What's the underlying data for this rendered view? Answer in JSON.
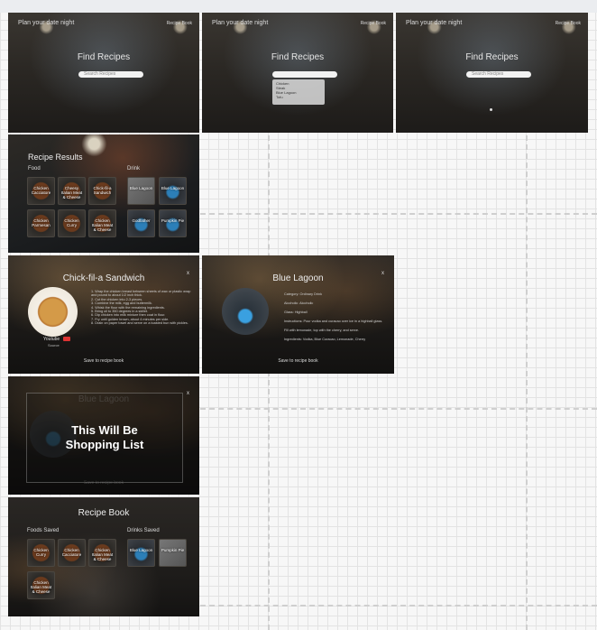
{
  "frames": {
    "landing": {
      "nav_title": "Plan your date night",
      "nav_link": "Recipe Book",
      "find_title": "Find Recipes",
      "search_placeholder": "Search Recipes"
    },
    "dropdown_options": [
      "Chicken",
      "Steak",
      "Blue Lagoon",
      "Tofu"
    ],
    "results": {
      "title": "Recipe Results",
      "food_label": "Food",
      "drink_label": "Drink",
      "food_tiles": [
        "Chicken Cacciatore",
        "Cheesy Italian Meat & Cheese",
        "Chick-fil-a Sandwich",
        "Chicken Parmesan",
        "Chicken Curry",
        "Chicken Italian Meat & Cheese"
      ],
      "drink_tiles": [
        "Blue Lagoon",
        "Blue Lagoon",
        "Godfather",
        "Pumpkin Pie"
      ]
    },
    "chick_modal": {
      "title": "Chick-fil-a Sandwich",
      "close": "x",
      "youtube_label": "Youtube",
      "source_label": "Source",
      "instructions": [
        "1. Wrap the chicken breast between sheets of wax or plastic wrap and pound to about 1/2 inch thick.",
        "2. Cut the chicken into 2-3 pieces.",
        "3. Combine the milk, egg and buttermilk.",
        "4. Whisk the flour with the remaining ingredients.",
        "5. Bring oil to 350 degrees in a skillet.",
        "6. Dip chicken into milk mixture then coat in flour.",
        "7. Fry until golden brown, about 4 minutes per side.",
        "8. Drain on paper towel and serve on a toasted bun with pickles."
      ],
      "save_label": "Save to recipe book"
    },
    "lagoon_modal": {
      "title": "Blue Lagoon",
      "close": "x",
      "details": [
        "Category: Ordinary Drink",
        "Alcoholic: Alcoholic",
        "Glass: Highball",
        "Instructions: Pour vodka and curacao over ice in a highball glass. Fill with lemonade, top with the cherry, and serve.",
        "Ingredients: Vodka, Blue Curacao, Lemonade, Cherry"
      ],
      "save_label": "Save to recipe book"
    },
    "shopping": {
      "faded_title": "Blue Lagoon",
      "message": "This Will Be Shopping List",
      "close": "x",
      "faded_save": "Save to recipe book"
    },
    "book": {
      "title": "Recipe Book",
      "foods_label": "Foods Saved",
      "drinks_label": "Drinks Saved",
      "food_tiles": [
        "Chicken Curry",
        "Chicken Cacciatore",
        "Chicken Italian Meat & Cheese",
        "Chicken Italian Meat & Cheese"
      ],
      "drink_tiles": [
        "Blue Lagoon",
        "Pumpkin Pie"
      ]
    }
  }
}
